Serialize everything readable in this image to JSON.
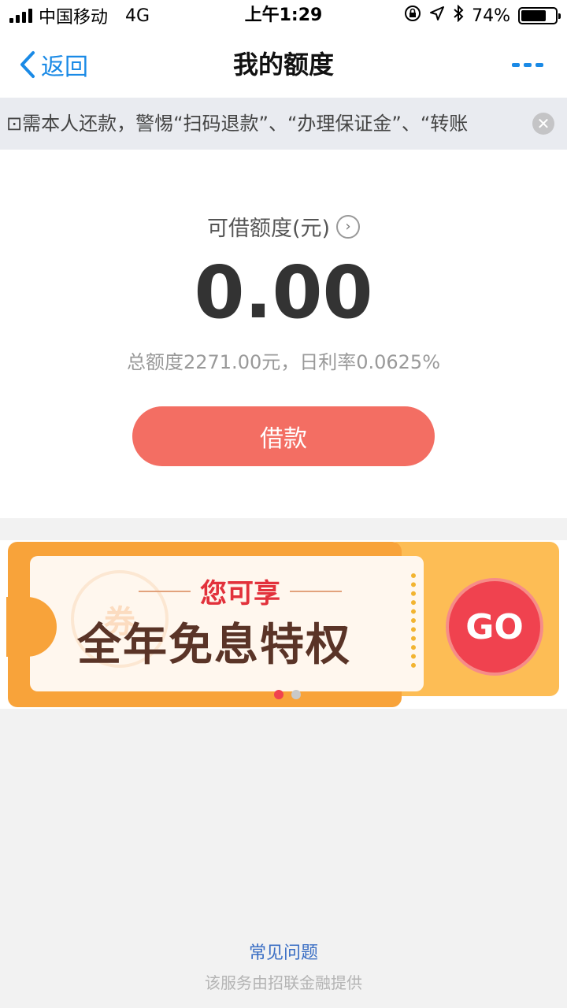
{
  "status_bar": {
    "carrier": "中国移动",
    "network": "4G",
    "time": "上午1:29",
    "battery": "74%",
    "battery_level": 0.74
  },
  "nav": {
    "back_label": "返回",
    "title": "我的额度"
  },
  "notice": {
    "text": "⊡需本人还款，警惕“扫码退款”、“办理保证金”、“转账"
  },
  "quota": {
    "label": "可借额度(元)",
    "amount": "0.00",
    "description": "总额度2271.00元，日利率0.0625%",
    "borrow_label": "借款"
  },
  "banner": {
    "stamp_text": "券",
    "subtitle": "您可享",
    "headline": "全年免息特权",
    "go_label": "GO",
    "active_dot": 0,
    "dot_count": 2,
    "colors": {
      "orange": "#f8a33a",
      "red": "#e2313b",
      "brown": "#5a3427"
    }
  },
  "footer": {
    "faq": "常见问题",
    "provider": "该服务由招联金融提供"
  },
  "colors": {
    "accent_blue": "#1a8ae6",
    "borrow_button": "#f36e63"
  }
}
